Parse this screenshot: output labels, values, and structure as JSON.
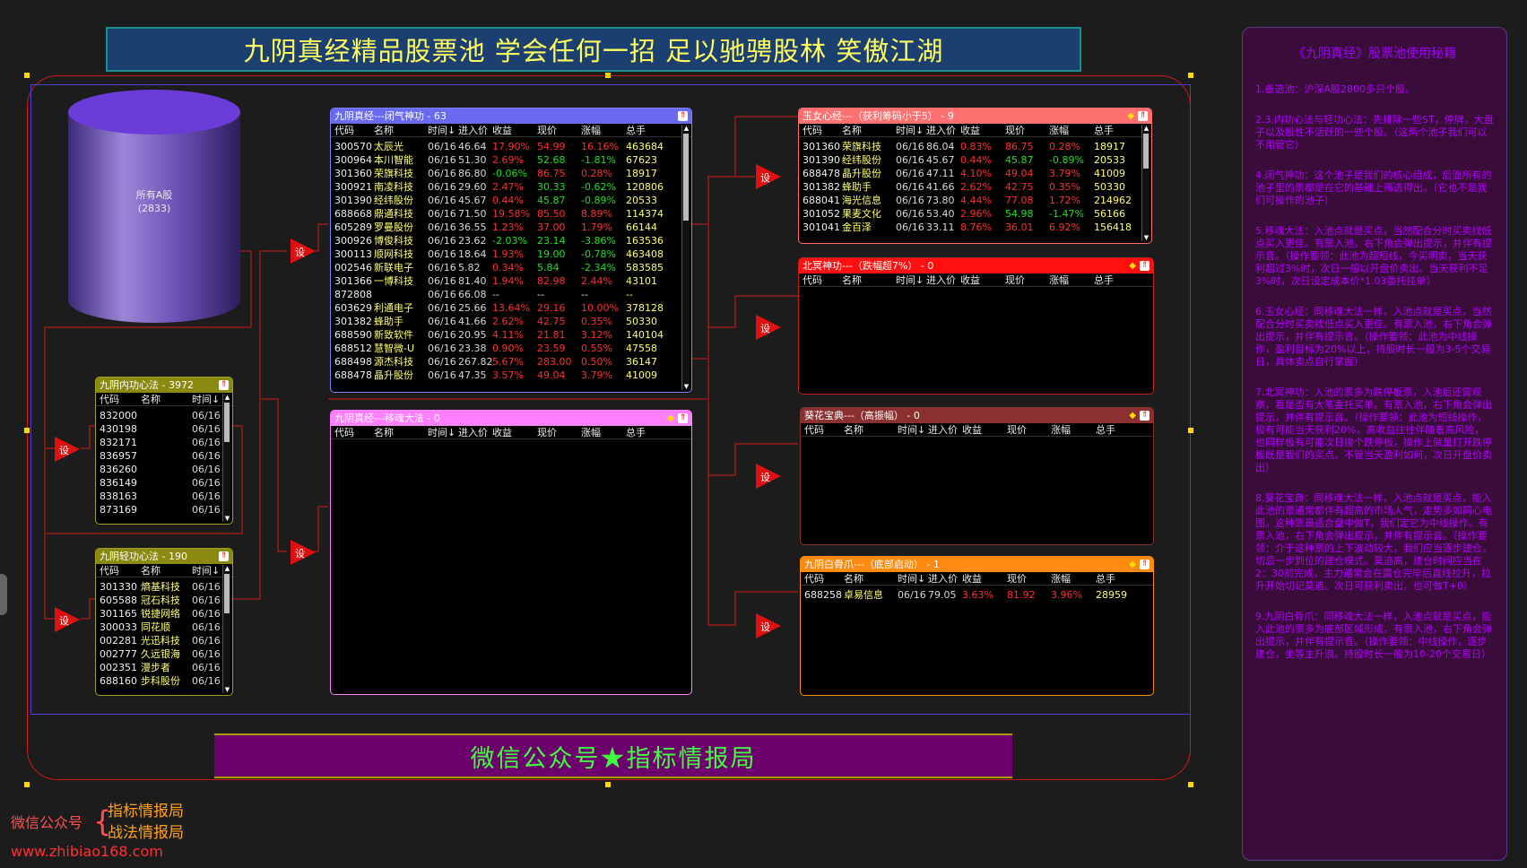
{
  "page": {
    "title": "九阴真经精品股票池 学会任何一招 足以驰骋股林 笑傲江湖",
    "bottom_banner": "微信公众号★指标情报局"
  },
  "cylinder": {
    "label": "所有A股",
    "count": "(2833)"
  },
  "set_label": "设",
  "columns": [
    "代码",
    "名称",
    "时间↓",
    "进入价",
    "收益",
    "现价",
    "涨幅",
    "总手"
  ],
  "small_columns": [
    "代码",
    "名称",
    "时间↓"
  ],
  "panels": {
    "wenqi": {
      "title": "九阴真经---闭气神功 - 63",
      "color": "#6a6af0",
      "rows": [
        [
          "300570",
          "太辰光",
          "06/16",
          "46.64",
          "17.90%",
          "54.99",
          "16.16%",
          "463684"
        ],
        [
          "300964",
          "本川智能",
          "06/16",
          "51.30",
          "2.69%",
          "52.68",
          "-1.81%",
          "67623"
        ],
        [
          "301360",
          "荣旗科技",
          "06/16",
          "86.80",
          "-0.06%",
          "86.75",
          "0.28%",
          "18917"
        ],
        [
          "300921",
          "南凌科技",
          "06/16",
          "29.60",
          "2.47%",
          "30.33",
          "-0.62%",
          "120806"
        ],
        [
          "301390",
          "经纬股份",
          "06/16",
          "45.67",
          "0.44%",
          "45.87",
          "-0.89%",
          "20533"
        ],
        [
          "688668",
          "鼎通科技",
          "06/16",
          "71.50",
          "19.58%",
          "85.50",
          "8.89%",
          "114374"
        ],
        [
          "605289",
          "罗曼股份",
          "06/16",
          "36.55",
          "1.23%",
          "37.00",
          "1.79%",
          "66144"
        ],
        [
          "300926",
          "博俊科技",
          "06/16",
          "23.62",
          "-2.03%",
          "23.14",
          "-3.86%",
          "163536"
        ],
        [
          "300113",
          "顺网科技",
          "06/16",
          "18.64",
          "1.93%",
          "19.00",
          "-0.78%",
          "463408"
        ],
        [
          "002546",
          "新联电子",
          "06/16",
          "5.82",
          "0.34%",
          "5.84",
          "-2.34%",
          "583585"
        ],
        [
          "301366",
          "一博科技",
          "06/16",
          "81.40",
          "1.94%",
          "82.98",
          "2.44%",
          "43101"
        ],
        [
          "872808",
          "",
          "06/16",
          "66.08",
          "--",
          "--",
          "--",
          "--"
        ],
        [
          "603629",
          "利通电子",
          "06/16",
          "25.66",
          "13.64%",
          "29.16",
          "10.00%",
          "378128"
        ],
        [
          "301382",
          "蜂助手",
          "06/16",
          "41.66",
          "2.62%",
          "42.75",
          "0.35%",
          "50330"
        ],
        [
          "688590",
          "新致软件",
          "06/16",
          "20.95",
          "4.11%",
          "21.81",
          "3.12%",
          "140104"
        ],
        [
          "688512",
          "慧智微-U",
          "06/16",
          "23.38",
          "0.90%",
          "23.59",
          "0.55%",
          "47558"
        ],
        [
          "688498",
          "源杰科技",
          "06/16",
          "267.82",
          "5.67%",
          "283.00",
          "0.50%",
          "36147"
        ],
        [
          "688478",
          "晶升股份",
          "06/16",
          "47.35",
          "3.57%",
          "49.04",
          "3.79%",
          "41009"
        ]
      ]
    },
    "yihun": {
      "title": "九阴真经---移魂大法 - 0",
      "color": "#ff80ff",
      "rows": []
    },
    "yunv": {
      "title": "玉女心经---（获利筹码小于5） - 9",
      "color": "#ff7070",
      "rows": [
        [
          "301360",
          "荣旗科技",
          "06/16",
          "86.04",
          "0.83%",
          "86.75",
          "0.28%",
          "18917"
        ],
        [
          "301390",
          "经纬股份",
          "06/16",
          "45.67",
          "0.44%",
          "45.87",
          "-0.89%",
          "20533"
        ],
        [
          "688478",
          "晶升股份",
          "06/16",
          "47.11",
          "4.10%",
          "49.04",
          "3.79%",
          "41009"
        ],
        [
          "301382",
          "蜂助手",
          "06/16",
          "41.66",
          "2.62%",
          "42.75",
          "0.35%",
          "50330"
        ],
        [
          "688041",
          "海光信息",
          "06/16",
          "73.80",
          "4.44%",
          "77.08",
          "1.72%",
          "214962"
        ],
        [
          "301052",
          "果麦文化",
          "06/16",
          "53.40",
          "2.96%",
          "54.98",
          "-1.47%",
          "56166"
        ],
        [
          "301041",
          "金百泽",
          "06/16",
          "33.11",
          "8.76%",
          "36.01",
          "6.92%",
          "156418"
        ]
      ]
    },
    "beiming": {
      "title": "北冥神功---（跌幅超7%） - 0",
      "color": "#ff1010",
      "rows": []
    },
    "kuihua": {
      "title": "葵花宝典---（高振幅） - 0",
      "color": "#8a3030",
      "rows": []
    },
    "baigu": {
      "title": "九阴白骨爪---（底部启动） - 1",
      "color": "#ff8a10",
      "rows": [
        [
          "688258",
          "卓易信息",
          "06/16",
          "79.05",
          "3.63%",
          "81.92",
          "3.96%",
          "28959"
        ]
      ]
    },
    "neigong": {
      "title": "九阴内功心法 - 3972",
      "color": "#8a8a10",
      "rows": [
        [
          "832000",
          "",
          "06/16"
        ],
        [
          "430198",
          "",
          "06/16"
        ],
        [
          "832171",
          "",
          "06/16"
        ],
        [
          "836957",
          "",
          "06/16"
        ],
        [
          "836260",
          "",
          "06/16"
        ],
        [
          "836149",
          "",
          "06/16"
        ],
        [
          "838163",
          "",
          "06/16"
        ],
        [
          "873169",
          "",
          "06/16"
        ]
      ]
    },
    "qinggong": {
      "title": "九阴轻功心法 - 190",
      "color": "#8a8a10",
      "rows": [
        [
          "301330",
          "熵基科技",
          "06/16"
        ],
        [
          "605588",
          "冠石科技",
          "06/16"
        ],
        [
          "301165",
          "锐捷网络",
          "06/16"
        ],
        [
          "300033",
          "同花顺",
          "06/16"
        ],
        [
          "002281",
          "光迅科技",
          "06/16"
        ],
        [
          "002777",
          "久远银海",
          "06/16"
        ],
        [
          "002351",
          "漫步者",
          "06/16"
        ],
        [
          "688160",
          "步科股份",
          "06/16"
        ]
      ]
    }
  },
  "logo": {
    "prefix": "微信公众号",
    "line1": "指标情报局",
    "line2": "战法情报局",
    "url": "www.zhibiao168.com"
  },
  "guide": {
    "title": "《九阴真经》股票池使用秘籍",
    "paragraphs": [
      "1.备选池：沪深A股2800多只个股。",
      "2.3.内功心法与轻功心法：先排除一些ST，停牌，大盘子以及股性不活跃的一些个股。（这两个池子我们可以不用管它）",
      "4.闭气神功：这个池子是我们的核心组成，后面所有的池子里的票都是在它的基础上筛选得出。（它也不是我们可操作的池子）",
      "5.移魂大法：入池点就是买点，当然配合分时买卖找低点买入更佳。有票入池，右下角会弹出提示，并伴有提示音。（操作要领：此池为超短线，今买明卖，当天获利超过3%时，次日一般以开盘价卖出。当天获利不足3%时，次日设定成本价*1.03委托挂单）",
      "6.玉女心经：同移魂大法一样，入池点就是买点，当然配合分时买卖找低点买入更佳。有票入池，右下角会弹出提示，并伴有提示音。（操作要领：此池为中线操作，盈利目标为20%以上，持股时长一般为3-5个交易日，具体卖点自行掌握）",
      "7.北冥神功：入池的票多为跌停板票，入池后还需观察，看是否有大笔委托买单。有票入池，右下角会弹出提示，并伴有提示音。（操作要领：此池为短线操作，极有可能当天获利20%，高收益往往伴随着高风险，也同样极有可能次日接个跌停板，操作上就量打开跌停板既是我们的买点，不管当天盈利如何，次日开盘价卖出）",
      "8.葵花宝典：同移魂大法一样，入池点就是买点，能入此池的票通常都伴有超高的市场人气，走势多如同心电图。这种票最适合盘中做T，我们定它为中线操作。有票入池，右下角会弹出提示，并伴有提示音。（操作要领：介于这种票的上下波动较大，我们应当逐步建仓，切忌一步到位的建仓模式。莫追高，建仓时间应当在2：30前完成，主力通常会在震仓完毕后直线拉升，拉升开始切记莫追。次日可获利卖出，也可做T+0）",
      "9.九阴白骨爪：同移魂大法一样，入池点就是买点，能入此池的票多为底部区域形成，有票入池，右下角会弹出提示，并伴有提示音。（操作要领：中线操作，逐步建仓，坐等主升浪。持股时长一般为10-20个交易日）"
    ]
  }
}
